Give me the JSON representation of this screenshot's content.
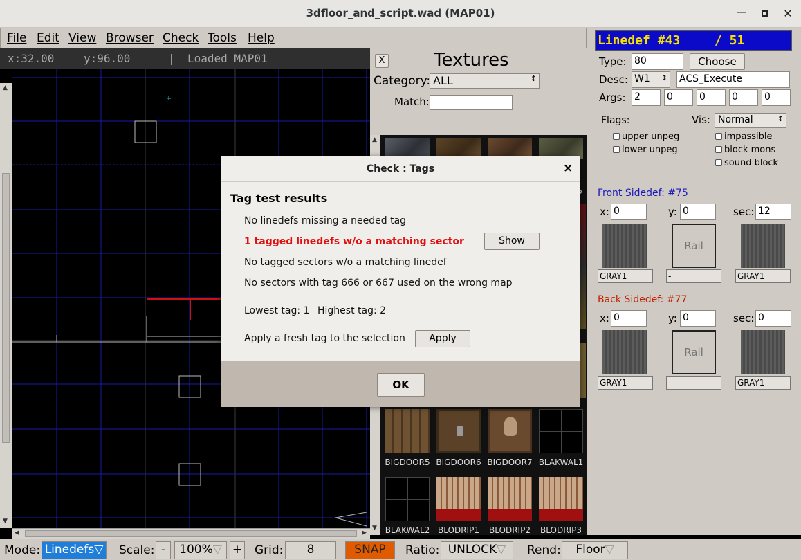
{
  "window": {
    "title": "3dfloor_and_script.wad (MAP01)"
  },
  "menu": [
    "File",
    "Edit",
    "View",
    "Browser",
    "Check",
    "Tools",
    "Help"
  ],
  "info": {
    "x": "x:32.00",
    "y": "y:96.00",
    "sep": "|",
    "status": "Loaded MAP01"
  },
  "textures": {
    "close": "X",
    "title": "Textures",
    "category_label": "Category:",
    "category_value": "ALL",
    "match_label": "Match:",
    "match_value": "",
    "partial_label": "5",
    "row1": [
      "BIGDOOR5",
      "BIGDOOR6",
      "BIGDOOR7",
      "BLAKWAL1"
    ],
    "row2": [
      "BLAKWAL2",
      "BLODRIP1",
      "BLODRIP2",
      "BLODRIP3"
    ]
  },
  "linedef": {
    "title": "Linedef #43",
    "count": "/ 51",
    "type_label": "Type:",
    "type_value": "80",
    "choose_label": "Choose",
    "desc_label": "Desc:",
    "desc_trigger": "W1",
    "desc_value": "ACS_Execute",
    "args_label": "Args:",
    "args": [
      "2",
      "0",
      "0",
      "0",
      "0"
    ],
    "flags_label": "Flags:",
    "vis_label": "Vis:",
    "vis_value": "Normal",
    "flags_left": [
      "upper unpeg",
      "lower unpeg"
    ],
    "flags_right": [
      "impassible",
      "block mons",
      "sound block"
    ]
  },
  "front": {
    "title": "Front Sidedef: #75",
    "x_label": "x:",
    "x": "0",
    "y_label": "y:",
    "y": "0",
    "sec_label": "sec:",
    "sec": "12",
    "upper": "GRAY1",
    "rail": "Rail",
    "mid": "-",
    "lower": "GRAY1"
  },
  "back": {
    "title": "Back Sidedef: #77",
    "x_label": "x:",
    "x": "0",
    "y_label": "y:",
    "y": "0",
    "sec_label": "sec:",
    "sec": "0",
    "upper": "GRAY1",
    "rail": "Rail",
    "mid": "-",
    "lower": "GRAY1"
  },
  "bottombar": {
    "mode_label": "Mode:",
    "mode_value": "Linedefs",
    "scale_label": "Scale:",
    "scale_minus": "-",
    "scale_value": "100%",
    "scale_plus": "+",
    "grid_label": "Grid:",
    "grid_value": "8",
    "snap_label": "SNAP",
    "ratio_label": "Ratio:",
    "ratio_value": "UNLOCK",
    "rend_label": "Rend:",
    "rend_value": "Floor"
  },
  "dialog": {
    "title": "Check : Tags",
    "close": "×",
    "heading": "Tag test results",
    "line1": "No linedefs missing a needed tag",
    "line2": "1 tagged linedefs w/o a matching sector",
    "show_label": "Show",
    "line3": "No tagged sectors w/o a matching linedef",
    "line4": "No sectors with tag 666 or 667 used on the wrong map",
    "lowest_label": "Lowest tag: 1",
    "highest_label": "Highest tag: 2",
    "apply_text": "Apply a fresh tag to the selection",
    "apply_label": "Apply",
    "ok_label": "OK"
  },
  "colors": {
    "grid_major": "#1a1aa8",
    "grid_minor": "#4a4a4a",
    "selection": "#cc1111",
    "header_bg": "#0a0ac8",
    "header_fg": "#f5e000",
    "snap_bg": "#e05a00",
    "mode_bg": "#1f7fd8",
    "warning_text": "#e01010"
  },
  "icons": [
    "minimize-icon",
    "maximize-icon",
    "close-icon",
    "dropdown-arrow-icon",
    "scroll-up-icon",
    "scroll-down-icon",
    "scroll-left-icon",
    "scroll-right-icon"
  ]
}
